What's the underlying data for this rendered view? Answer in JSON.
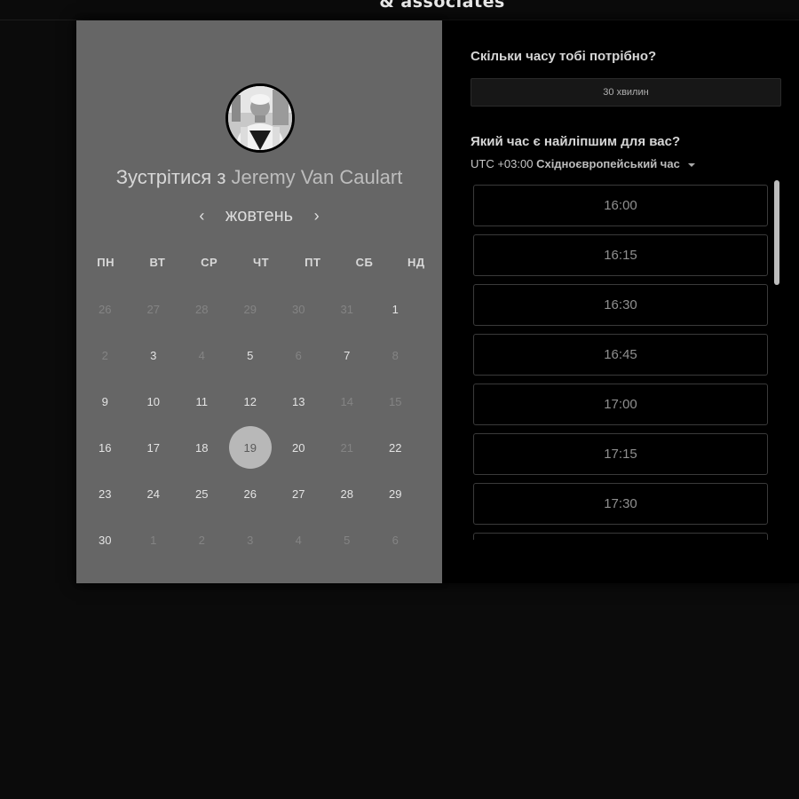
{
  "brand": {
    "text": "& associates"
  },
  "host": {
    "prefix": "Зустрітися з",
    "name": "Jeremy Van Caulart"
  },
  "calendar": {
    "month": "жовтень",
    "prev_label": "‹",
    "next_label": "›",
    "weekdays": [
      "ПН",
      "ВТ",
      "СР",
      "ЧТ",
      "ПТ",
      "СБ",
      "НД"
    ],
    "weeks": [
      [
        {
          "d": "26",
          "m": true
        },
        {
          "d": "27",
          "m": true
        },
        {
          "d": "28",
          "m": true
        },
        {
          "d": "29",
          "m": true
        },
        {
          "d": "30",
          "m": true
        },
        {
          "d": "31",
          "m": true
        },
        {
          "d": "1"
        }
      ],
      [
        {
          "d": "2",
          "m": true
        },
        {
          "d": "3"
        },
        {
          "d": "4",
          "m": true
        },
        {
          "d": "5"
        },
        {
          "d": "6",
          "m": true
        },
        {
          "d": "7"
        },
        {
          "d": "8",
          "m": true
        }
      ],
      [
        {
          "d": "9"
        },
        {
          "d": "10"
        },
        {
          "d": "11"
        },
        {
          "d": "12"
        },
        {
          "d": "13"
        },
        {
          "d": "14",
          "m": true
        },
        {
          "d": "15",
          "m": true
        }
      ],
      [
        {
          "d": "16"
        },
        {
          "d": "17"
        },
        {
          "d": "18"
        },
        {
          "d": "19",
          "s": true
        },
        {
          "d": "20"
        },
        {
          "d": "21",
          "m": true
        },
        {
          "d": "22"
        }
      ],
      [
        {
          "d": "23"
        },
        {
          "d": "24"
        },
        {
          "d": "25"
        },
        {
          "d": "26"
        },
        {
          "d": "27"
        },
        {
          "d": "28"
        },
        {
          "d": "29"
        }
      ],
      [
        {
          "d": "30"
        },
        {
          "d": "1",
          "m": true
        },
        {
          "d": "2",
          "m": true
        },
        {
          "d": "3",
          "m": true
        },
        {
          "d": "4",
          "m": true
        },
        {
          "d": "5",
          "m": true
        },
        {
          "d": "6",
          "m": true
        }
      ]
    ]
  },
  "duration": {
    "question": "Скільки часу тобі потрібно?",
    "selected": "30 хвилин"
  },
  "time": {
    "question": "Який час є найліпшим для вас?",
    "timezone_offset": "UTC +03:00",
    "timezone_name": "Східноєвропейський час",
    "slots": [
      "16:00",
      "16:15",
      "16:30",
      "16:45",
      "17:00",
      "17:15",
      "17:30",
      ""
    ]
  },
  "colors": {
    "page_bg": "#0b0b0b",
    "left_panel": "#666666",
    "right_panel": "#000000",
    "selected_day": "#b8b8b8"
  }
}
